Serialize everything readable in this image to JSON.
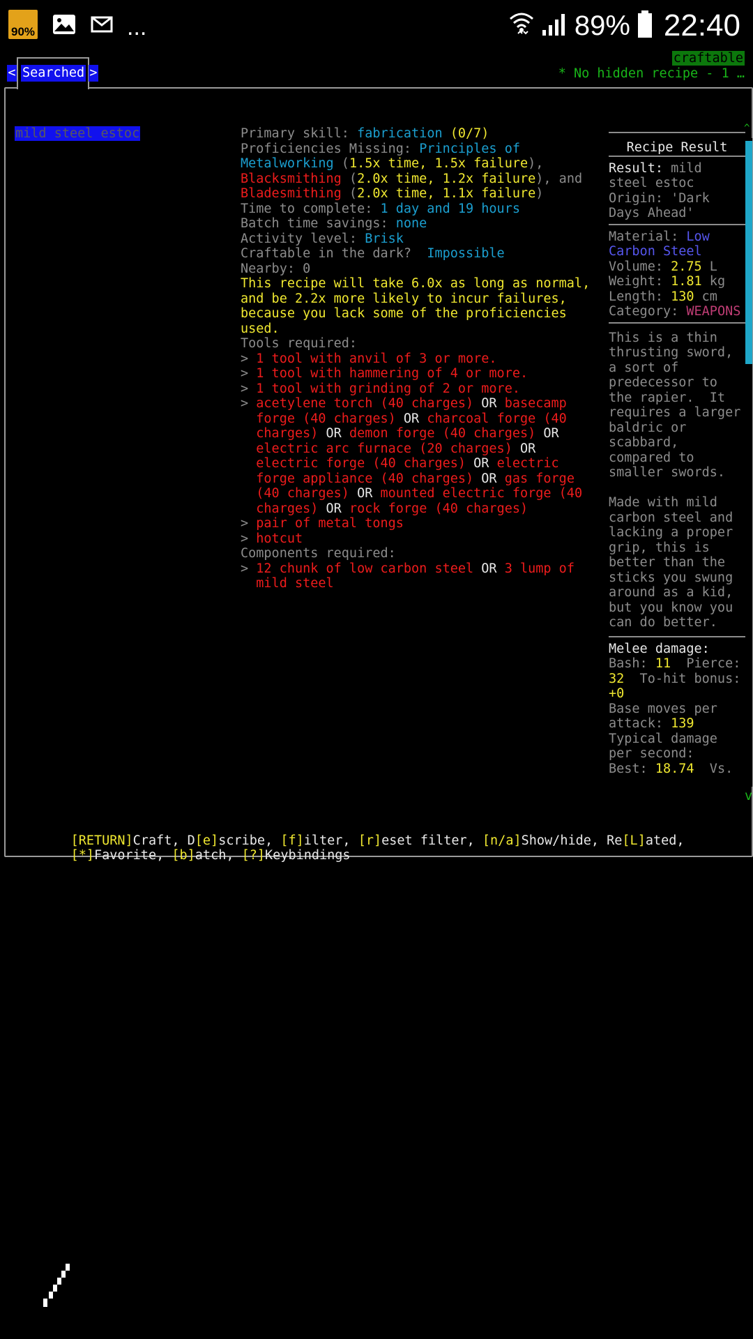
{
  "statusbar": {
    "app_badge": "90%",
    "more": "...",
    "battery_percent": "89%",
    "time": "22:40",
    "icons": [
      "gallery-icon",
      "mail-icon",
      "wifi-icon",
      "signal-icon",
      "battery-icon"
    ]
  },
  "header": {
    "tab_prev": "<",
    "tab_label": "Searched",
    "tab_next": ">",
    "craftable": "craftable",
    "hidden_note": "* No hidden recipe - 1 …"
  },
  "recipe_list": {
    "selected": "mild steel estoc"
  },
  "details": {
    "primary_skill_label": "Primary skill: ",
    "primary_skill_value": "fabrication",
    "primary_skill_level": "(0/7)",
    "prof_label": "Proficiencies Missing: ",
    "prof1_a": "Principles of",
    "prof1_b": "Metalworking",
    "prof1_mod": "1.5x time, 1.5x failure",
    "prof2": "Blacksmithing",
    "prof2_mod": "2.0x time, 1.2x failure",
    "and": ", and",
    "prof3": "Bladesmithing",
    "prof3_mod": "2.0x time, 1.1x failure",
    "time_label": "Time to complete: ",
    "time_value": "1 day and 19 hours",
    "batch_label": "Batch time savings: ",
    "batch_value": "none",
    "activity_label": "Activity level: ",
    "activity_value": "Brisk",
    "dark_label": "Craftable in the dark?  ",
    "dark_value": "Impossible",
    "nearby": "Nearby: 0",
    "warning": [
      "This recipe will take 6.0x as long as normal,",
      "and be 2.2x more likely to incur failures,",
      "because you lack some of the proficiencies",
      "used."
    ],
    "tools_label": "Tools required:",
    "tool1": "1 tool with anvil of 3 or more.",
    "tool2": "1 tool with hammering of 4 or more.",
    "tool3": "1 tool with grinding of 2 or more.",
    "heat": {
      "t1": "acetylene torch (40 charges)",
      "t2a": "basecamp",
      "t2b": "forge (40 charges)",
      "t3a": "charcoal forge (40",
      "t3b": "charges)",
      "t4": "demon forge (40 charges)",
      "t5": "electric arc furnace (20 charges)",
      "t6": "electric forge (40 charges)",
      "t7a": "electric",
      "t7b": "forge appliance (40 charges)",
      "t8a": "gas forge",
      "t8b": "(40 charges)",
      "t9a": "mounted electric forge (40",
      "t9b": "charges)",
      "t10": "rock forge (40 charges)",
      "or": "OR"
    },
    "tool5": "pair of metal tongs",
    "tool6": "hotcut",
    "components_label": "Components required:",
    "comp_a": "12 chunk of low carbon steel",
    "comp_b": "3 lump of",
    "comp_c": "mild steel"
  },
  "result_panel": {
    "title": "Recipe Result",
    "result_label": "Result:",
    "result_1": " mild",
    "result_2": "steel estoc",
    "origin_1": "Origin: 'Dark",
    "origin_2": "Days Ahead'",
    "material_label": "Material: ",
    "material_1": "Low",
    "material_2": "Carbon Steel",
    "volume_label": "Volume: ",
    "volume_value": "2.75",
    "volume_unit": " L",
    "weight_label": "Weight: ",
    "weight_value": "1.81",
    "weight_unit": " kg",
    "length_label": "Length: ",
    "length_value": "130",
    "length_unit": " cm",
    "category_label": "Category: ",
    "category_value": "WEAPONS",
    "desc1": [
      "This is a thin",
      "thrusting sword,",
      "a sort of",
      "predecessor to",
      "the rapier.  It",
      "requires a larger",
      "baldric or",
      "scabbard,",
      "compared to",
      "smaller swords."
    ],
    "desc2": [
      "Made with mild",
      "carbon steel and",
      "lacking a proper",
      "grip, this is",
      "better than the",
      "sticks you swung",
      "around as a kid,",
      "but you know you",
      "can do better."
    ],
    "melee_label": "Melee damage:",
    "bash_label": "Bash: ",
    "bash_value": "11",
    "pierce_label": "  Pierce:",
    "pierce_value": "32",
    "tohit_label": "  To-hit bonus:",
    "tohit_value": "+0",
    "moves_1": "Base moves per",
    "moves_label": "attack: ",
    "moves_value": "139",
    "dps_1": "Typical damage",
    "dps_2": "per second:",
    "best_label": "Best: ",
    "best_value": "18.74",
    "vs_label": "  Vs.",
    "scroll_up": "^",
    "edge_v": "v"
  },
  "keybindings": {
    "k_return": "[RETURN]",
    "t_craft": "Craft, D",
    "k_e": "[e]",
    "t_scribe": "scribe, ",
    "k_f": "[f]",
    "t_ilter": "ilter, ",
    "k_r": "[r]",
    "t_eset": "eset filter, ",
    "k_na": "[n/a]",
    "t_show": "Show/hide, Re",
    "k_l": "[L]",
    "t_ated": "ated,",
    "k_star": "[*]",
    "t_fav": "Favorite, ",
    "k_b": "[b]",
    "t_atch": "atch, ",
    "k_q": "[?]",
    "t_keys": "Keybindings"
  }
}
